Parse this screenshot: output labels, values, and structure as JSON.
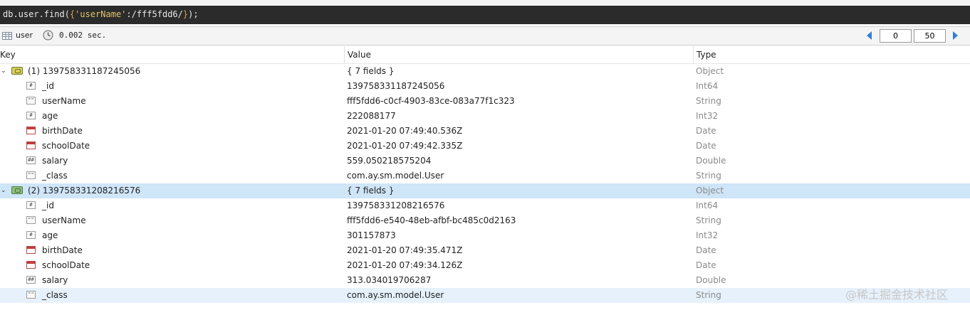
{
  "query": {
    "prefix": "db.user.find(",
    "open": "{",
    "key": "'userName'",
    "middle": ":/fff5fdd6/",
    "close": "}",
    "suffix": ");"
  },
  "toolbar": {
    "collection": "user",
    "time": "0.002 sec.",
    "page_start": "0",
    "page_size": "50"
  },
  "columns": {
    "key": "Key",
    "value": "Value",
    "type": "Type"
  },
  "documents": [
    {
      "key": "(1) 139758331187245056",
      "value": "{ 7 fields }",
      "type": "Object",
      "fields": [
        {
          "key": "_id",
          "value": "139758331187245056",
          "type": "Int64",
          "icon": "#"
        },
        {
          "key": "userName",
          "value": "fff5fdd6-c0cf-4903-83ce-083a77f1c323",
          "type": "String",
          "icon": "\"\""
        },
        {
          "key": "age",
          "value": "222088177",
          "type": "Int32",
          "icon": "#"
        },
        {
          "key": "birthDate",
          "value": "2021-01-20 07:49:40.536Z",
          "type": "Date",
          "icon": "date"
        },
        {
          "key": "schoolDate",
          "value": "2021-01-20 07:49:42.335Z",
          "type": "Date",
          "icon": "date"
        },
        {
          "key": "salary",
          "value": "559.050218575204",
          "type": "Double",
          "icon": "##"
        },
        {
          "key": "_class",
          "value": "com.ay.sm.model.User",
          "type": "String",
          "icon": "\"\""
        }
      ]
    },
    {
      "key": "(2) 139758331208216576",
      "value": "{ 7 fields }",
      "type": "Object",
      "fields": [
        {
          "key": "_id",
          "value": "139758331208216576",
          "type": "Int64",
          "icon": "#"
        },
        {
          "key": "userName",
          "value": "fff5fdd6-e540-48eb-afbf-bc485c0d2163",
          "type": "String",
          "icon": "\"\""
        },
        {
          "key": "age",
          "value": "301157873",
          "type": "Int32",
          "icon": "#"
        },
        {
          "key": "birthDate",
          "value": "2021-01-20 07:49:35.471Z",
          "type": "Date",
          "icon": "date"
        },
        {
          "key": "schoolDate",
          "value": "2021-01-20 07:49:34.126Z",
          "type": "Date",
          "icon": "date"
        },
        {
          "key": "salary",
          "value": "313.034019706287",
          "type": "Double",
          "icon": "##"
        },
        {
          "key": "_class",
          "value": "com.ay.sm.model.User",
          "type": "String",
          "icon": "\"\""
        }
      ]
    }
  ],
  "watermark": "@稀土掘金技术社区"
}
